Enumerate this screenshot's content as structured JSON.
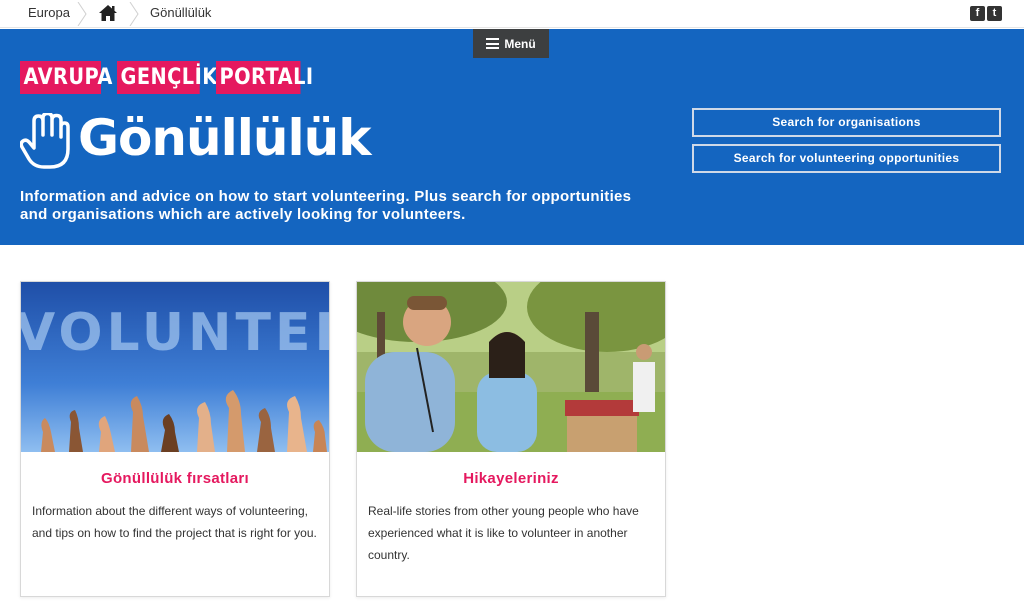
{
  "breadcrumb": {
    "items": [
      "Europa",
      "Gönüllülük"
    ],
    "home_icon": "home-icon"
  },
  "social": {
    "facebook": "f",
    "twitter": "t"
  },
  "hero": {
    "menu_label": "Menü",
    "portal_words": [
      "AVRUPA",
      "GENÇLİK",
      "PORTALI"
    ],
    "title": "Gönüllülük",
    "intro": "Information and advice on how to start volunteering. Plus search for opportunities and organisations which are actively looking for volunteers.",
    "search_organisations": "Search for organisations",
    "search_opportunities": "Search for volunteering opportunities"
  },
  "cards": [
    {
      "title": "Gönüllülük fırsatları",
      "text": "Information about the different ways of volunteering, and tips on how to find the project that is right for you.",
      "image_text": "VOLUNTEER"
    },
    {
      "title": "Hikayeleriniz",
      "text": "Real-life stories from other young people who have experienced what it is like to volunteer in another country."
    }
  ],
  "colors": {
    "hero_blue": "#1465c0",
    "accent_pink": "#e5195f",
    "menu_dark": "#3d3f40"
  }
}
